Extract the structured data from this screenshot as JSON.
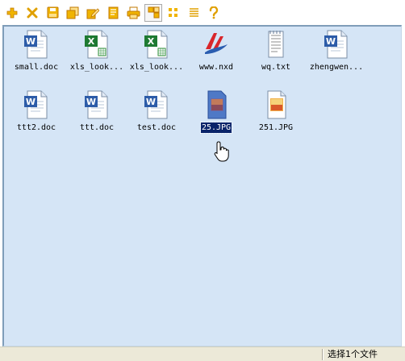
{
  "toolbar": {
    "buttons": [
      {
        "icon": "add-icon",
        "color": "#e2a000"
      },
      {
        "icon": "delete-icon",
        "color": "#e2a000"
      },
      {
        "icon": "save-icon",
        "color": "#e2a000"
      },
      {
        "icon": "copy-icon",
        "color": "#e2a000"
      },
      {
        "icon": "edit-icon",
        "color": "#e2a000"
      },
      {
        "icon": "properties-icon",
        "color": "#e2a000"
      },
      {
        "icon": "print-icon",
        "color": "#e2a000"
      },
      {
        "icon": "large-icons-view-icon",
        "color": "#e2a000",
        "active": true
      },
      {
        "icon": "small-icons-view-icon",
        "color": "#e2a000"
      },
      {
        "icon": "details-view-icon",
        "color": "#e2a000"
      },
      {
        "icon": "help-icon",
        "color": "#e2a000"
      }
    ]
  },
  "files": [
    {
      "name": "small.doc",
      "type": "word"
    },
    {
      "name": "xls_look...",
      "type": "excel"
    },
    {
      "name": "xls_look...",
      "type": "excel"
    },
    {
      "name": "www.nxd",
      "type": "nxd"
    },
    {
      "name": "wq.txt",
      "type": "text"
    },
    {
      "name": "zhengwen...",
      "type": "word"
    },
    {
      "name": "ttt2.doc",
      "type": "word"
    },
    {
      "name": "ttt.doc",
      "type": "word"
    },
    {
      "name": "test.doc",
      "type": "word"
    },
    {
      "name": "25.JPG",
      "type": "image",
      "selected": true
    },
    {
      "name": "251.JPG",
      "type": "image"
    }
  ],
  "status": {
    "text": "选择1个文件"
  },
  "colors": {
    "area_bg": "#d5e5f6",
    "selection": "#0a246a",
    "toolbar_icon": "#e2a000"
  }
}
